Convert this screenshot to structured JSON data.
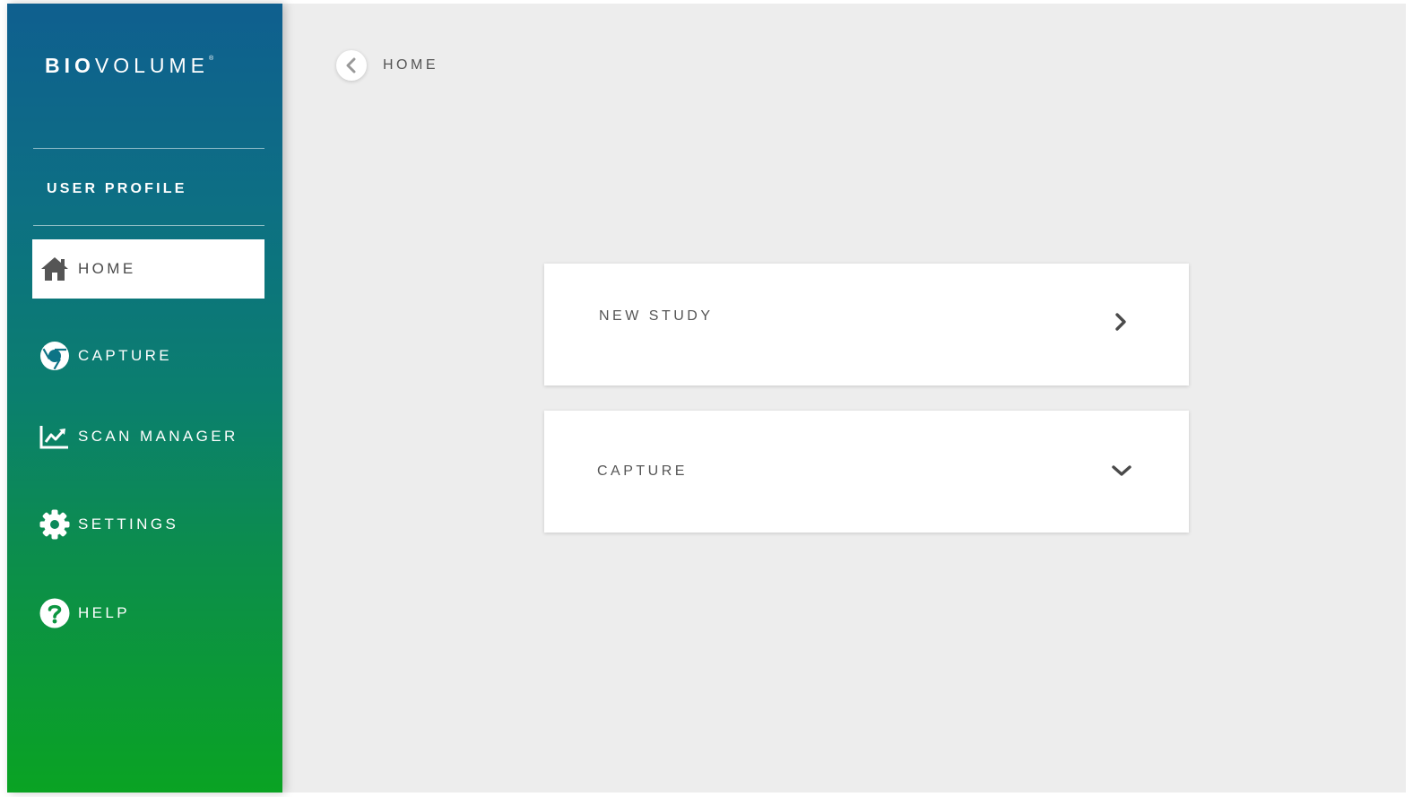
{
  "app": {
    "logo_bold": "BIO",
    "logo_light": "VOLUME",
    "logo_mark": "®"
  },
  "sidebar": {
    "user_profile_label": "USER PROFILE",
    "items": [
      {
        "label": "HOME",
        "icon": "home-icon",
        "active": true
      },
      {
        "label": "CAPTURE",
        "icon": "aperture-icon",
        "active": false
      },
      {
        "label": "SCAN MANAGER",
        "icon": "line-chart-icon",
        "active": false
      },
      {
        "label": "SETTINGS",
        "icon": "gear-icon",
        "active": false
      },
      {
        "label": "HELP",
        "icon": "help-circle-icon",
        "active": false
      }
    ]
  },
  "header": {
    "back_icon": "chevron-left-icon",
    "breadcrumb": "HOME"
  },
  "main": {
    "cards": [
      {
        "label": "NEW STUDY",
        "icon": "chevron-right-icon"
      },
      {
        "label": "CAPTURE",
        "icon": "chevron-down-icon"
      }
    ]
  },
  "colors": {
    "sidebar_top": "#0f5f8f",
    "sidebar_bottom": "#0aa323",
    "background": "#ededed",
    "text_gray": "#555555"
  }
}
